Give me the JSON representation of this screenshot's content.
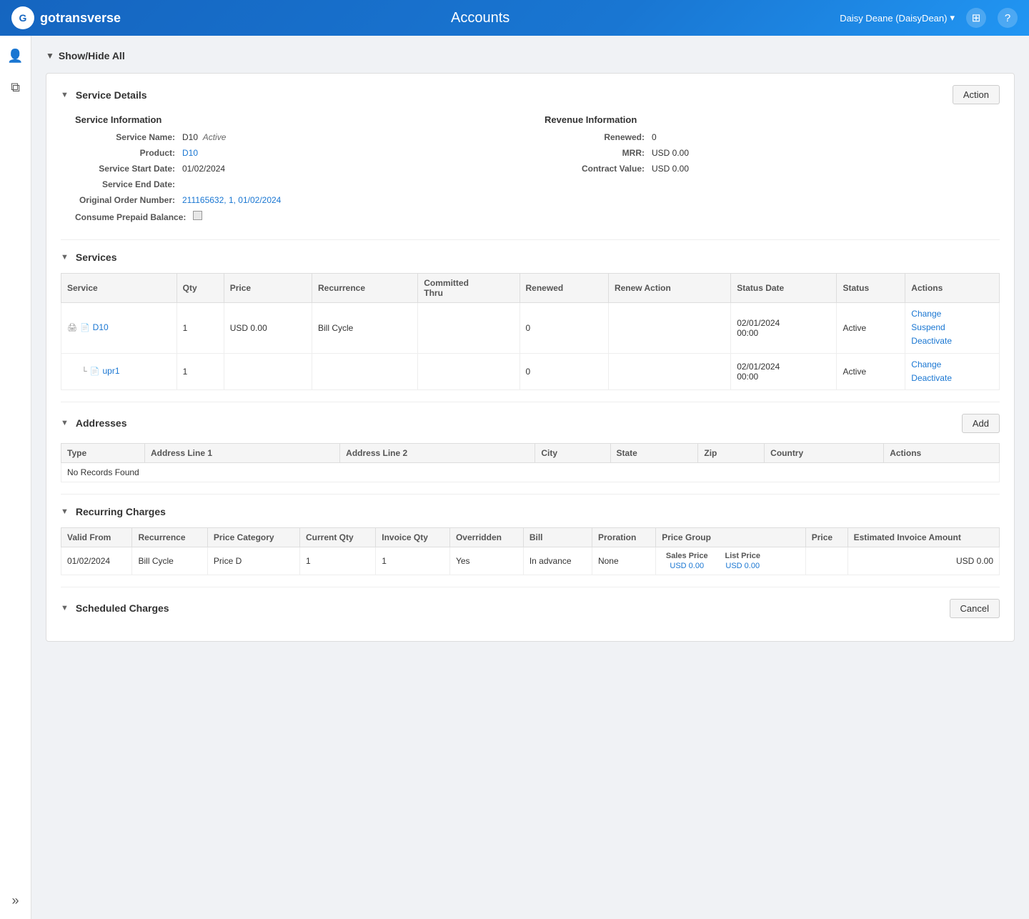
{
  "nav": {
    "logo_text": "G",
    "app_name": "gotransverse",
    "page_title": "Accounts",
    "user_name": "Daisy Deane (DaisyDean)",
    "user_dropdown": "▾"
  },
  "sidebar": {
    "icons": [
      {
        "name": "users-icon",
        "symbol": "👤"
      },
      {
        "name": "copy-icon",
        "symbol": "⧉"
      }
    ],
    "bottom": [
      {
        "name": "expand-icon",
        "symbol": "»"
      }
    ]
  },
  "show_hide_all": {
    "label": "Show/Hide All",
    "arrow": "▼"
  },
  "service_details": {
    "section_title": "Service Details",
    "action_button": "Action",
    "service_info": {
      "heading": "Service Information",
      "fields": [
        {
          "label": "Service Name:",
          "value": "D10",
          "extra": "Active",
          "type": "text_with_status"
        },
        {
          "label": "Product:",
          "value": "D10",
          "type": "link"
        },
        {
          "label": "Service Start Date:",
          "value": "01/02/2024",
          "type": "text"
        },
        {
          "label": "Service End Date:",
          "value": "",
          "type": "text"
        },
        {
          "label": "Original Order Number:",
          "value": "211165632, 1, 01/02/2024",
          "type": "link"
        },
        {
          "label": "Consume Prepaid Balance:",
          "value": "checkbox",
          "type": "checkbox"
        }
      ]
    },
    "revenue_info": {
      "heading": "Revenue Information",
      "fields": [
        {
          "label": "Renewed:",
          "value": "0",
          "type": "text"
        },
        {
          "label": "MRR:",
          "value": "USD 0.00",
          "type": "text"
        },
        {
          "label": "Contract Value:",
          "value": "USD 0.00",
          "type": "text"
        }
      ]
    }
  },
  "services_section": {
    "section_title": "Services",
    "table_headers": [
      "Service",
      "Qty",
      "Price",
      "Recurrence",
      "Committed Thru",
      "Renewed",
      "Renew Action",
      "Status Date",
      "Status",
      "Actions"
    ],
    "rows": [
      {
        "indent": 0,
        "service_name": "D10",
        "service_link": true,
        "icons": [
          "print",
          "doc"
        ],
        "qty": "1",
        "price": "USD 0.00",
        "recurrence": "Bill Cycle",
        "committed_thru": "",
        "renewed": "0",
        "renew_action": "",
        "status_date": "02/01/2024 00:00",
        "status": "Active",
        "actions": [
          "Change",
          "Suspend",
          "Deactivate"
        ]
      },
      {
        "indent": 1,
        "service_name": "upr1",
        "service_link": true,
        "icons": [
          "subdoc",
          "doc2"
        ],
        "qty": "1",
        "price": "",
        "recurrence": "",
        "committed_thru": "",
        "renewed": "0",
        "renew_action": "",
        "status_date": "02/01/2024 00:00",
        "status": "Active",
        "actions": [
          "Change",
          "Deactivate"
        ]
      }
    ]
  },
  "addresses_section": {
    "section_title": "Addresses",
    "add_button": "Add",
    "table_headers": [
      "Type",
      "Address Line 1",
      "Address Line 2",
      "City",
      "State",
      "Zip",
      "Country",
      "Actions"
    ],
    "no_records": "No Records Found"
  },
  "recurring_charges": {
    "section_title": "Recurring Charges",
    "table_headers": [
      "Valid From",
      "Recurrence",
      "Price Category",
      "Current Qty",
      "Invoice Qty",
      "Overridden",
      "Bill",
      "Proration",
      "Price Group",
      "Price",
      "Estimated Invoice Amount"
    ],
    "rows": [
      {
        "valid_from": "01/02/2024",
        "recurrence": "Bill Cycle",
        "price_category": "Price D",
        "current_qty": "1",
        "invoice_qty": "1",
        "overridden": "Yes",
        "bill": "In advance",
        "proration": "None",
        "price_group": {
          "sales_price_label": "Sales Price",
          "list_price_label": "List Price",
          "sales_price_val": "USD 0.00",
          "list_price_val": "USD 0.00"
        },
        "price": "",
        "estimated_invoice": "USD 0.00"
      }
    ]
  },
  "scheduled_charges": {
    "section_title": "Scheduled Charges",
    "cancel_button": "Cancel"
  }
}
